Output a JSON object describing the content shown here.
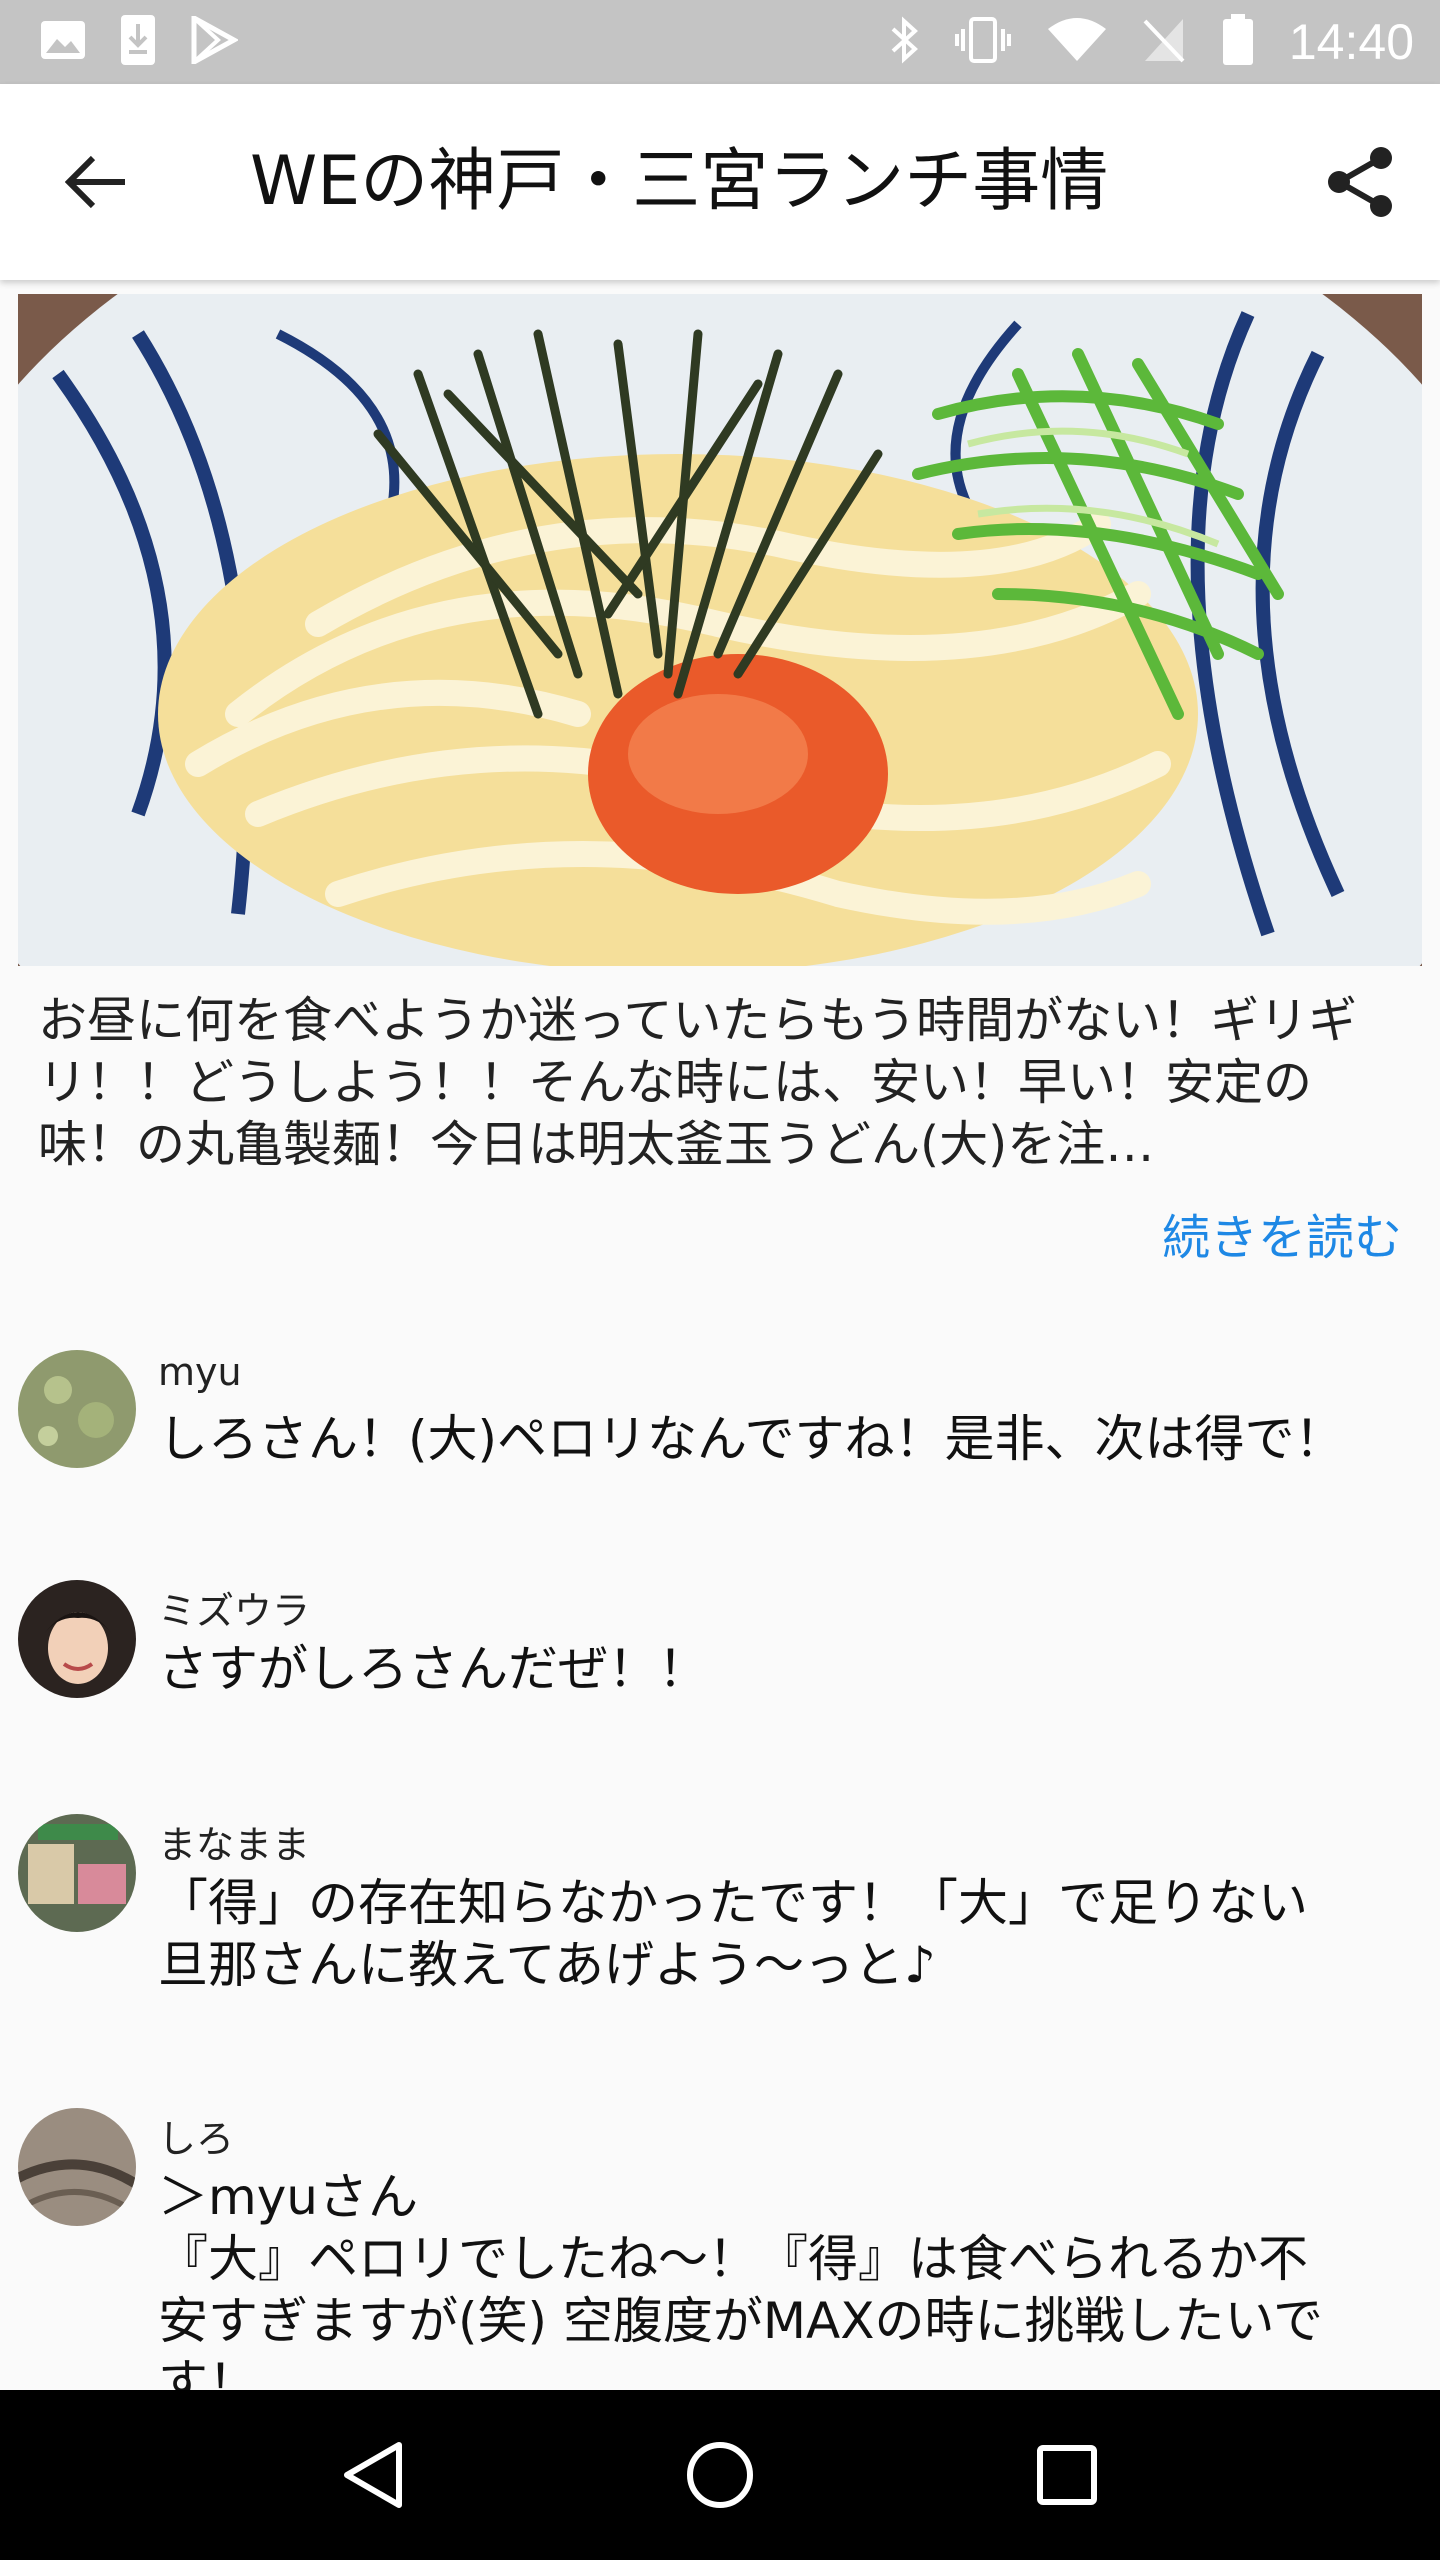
{
  "status_bar": {
    "time": "14:40",
    "left_icons": [
      "image-icon",
      "download-icon",
      "play-store-icon"
    ],
    "right_icons": [
      "bluetooth-icon",
      "vibrate-icon",
      "wifi-icon",
      "no-sim-icon",
      "battery-icon"
    ]
  },
  "app_bar": {
    "title": "WEの神戸・三宮ランチ事情",
    "back_icon": "arrow-back-icon",
    "share_icon": "share-icon"
  },
  "post": {
    "text": "お昼に何を食べようか迷っていたらもう時間がない！ギリギリ！！どうしよう！！そんな時には、安い！早い！安定の味！の丸亀製麺！今日は明太釜玉うどん(大)を注…",
    "read_more": "続きを読む"
  },
  "comments": [
    {
      "name": "myu",
      "text": "しろさん！(大)ペロリなんですね！是非、次は得で！"
    },
    {
      "name": "ミズウラ",
      "text": "さすがしろさんだぜ！！"
    },
    {
      "name": "まなまま",
      "text": "「得」の存在知らなかったです！「大」で足りない\n旦那さんに教えてあげよう〜っと♪"
    },
    {
      "name": "しろ",
      "text": "＞myuさん\n『大』ペロリでしたね〜！『得』は食べられるか不\n安すぎますが(笑) 空腹度がMAXの時に挑戦したいで\nす！"
    }
  ],
  "nav_bar": {
    "icons": [
      "back-triangle-icon",
      "home-circle-icon",
      "recents-square-icon"
    ]
  },
  "colors": {
    "status_bar": "#c4c4c4",
    "link": "#1e88e5",
    "nav_bar": "#000000"
  }
}
